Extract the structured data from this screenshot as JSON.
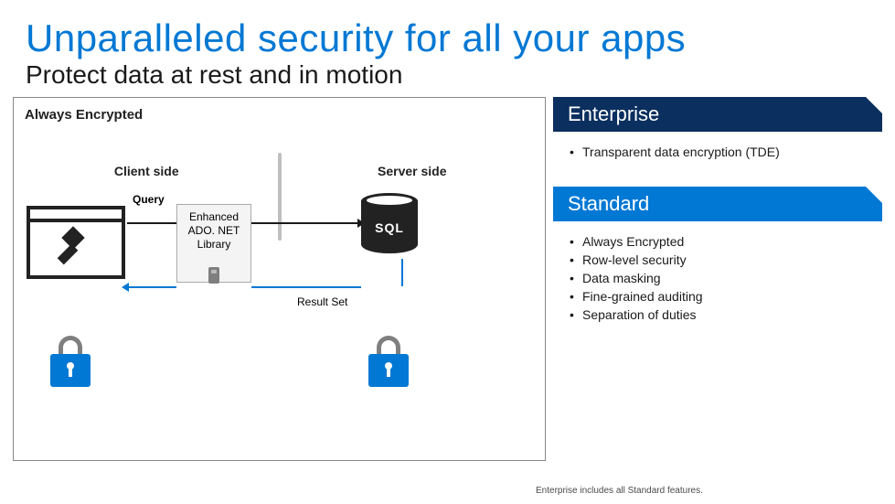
{
  "title": "Unparalleled security for all your apps",
  "subtitle": "Protect data at rest and in motion",
  "diagram": {
    "heading": "Always Encrypted",
    "client_side": "Client side",
    "server_side": "Server side",
    "query_label": "Query",
    "library_label": "Enhanced ADO. NET Library",
    "db_label": "SQL",
    "result_label": "Result Set"
  },
  "tiers": {
    "enterprise": {
      "label": "Enterprise",
      "features": [
        "Transparent data encryption (TDE)"
      ]
    },
    "standard": {
      "label": "Standard",
      "features": [
        "Always Encrypted",
        "Row-level security",
        "Data masking",
        "Fine-grained auditing",
        "Separation of duties"
      ]
    }
  },
  "footnote": "Enterprise includes all Standard features."
}
